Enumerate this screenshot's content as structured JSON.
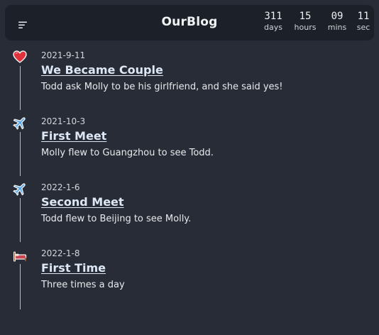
{
  "header": {
    "title": "OurBlog",
    "menu_icon": "menu-icon",
    "countdown": [
      {
        "value": "311",
        "unit": "days"
      },
      {
        "value": "15",
        "unit": "hours"
      },
      {
        "value": "09",
        "unit": "mins"
      },
      {
        "value": "11",
        "unit": "sec"
      }
    ]
  },
  "timeline": {
    "events": [
      {
        "icon": "heart-icon",
        "date": "2021-9-11",
        "title": "We Became Couple",
        "description": "Todd ask Molly to be his girlfriend, and she said yes!"
      },
      {
        "icon": "airplane-icon",
        "date": "2021-10-3",
        "title": "First Meet",
        "description": "Molly flew to Guangzhou to see Todd."
      },
      {
        "icon": "airplane-icon",
        "date": "2022-1-6",
        "title": "Second Meet",
        "description": "Todd flew to Beijing to see Molly."
      },
      {
        "icon": "bed-icon",
        "date": "2022-1-8",
        "title": "First Time",
        "description": "Three times a day"
      }
    ]
  },
  "colors": {
    "background": "#272c36",
    "header_bg": "#1c2028",
    "heart": "#e0313d",
    "airplane": "#5aa7e6",
    "bed": "#c9454f"
  }
}
